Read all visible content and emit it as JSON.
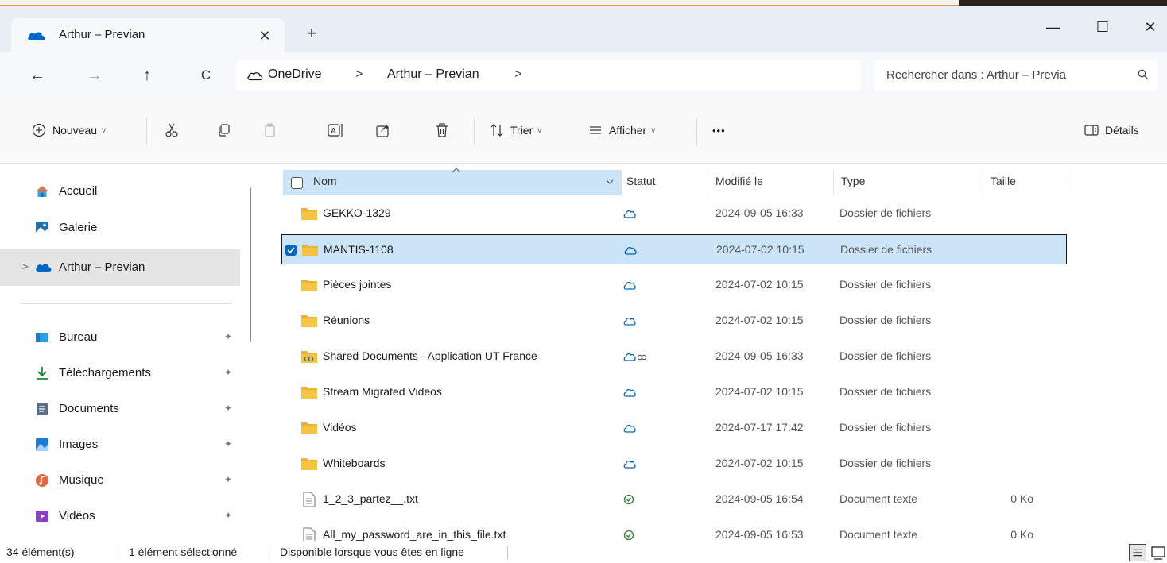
{
  "window": {
    "tab_title": "Arthur – Previan",
    "tab_close": "✕",
    "new_tab": "+",
    "minimize": "—",
    "maximize": "☐",
    "close": "✕"
  },
  "nav": {
    "back": "←",
    "forward": "→",
    "up": "↑",
    "refresh": "C"
  },
  "address": {
    "crumbs": [
      "OneDrive",
      "Arthur – Previan"
    ],
    "sep": ">"
  },
  "search": {
    "placeholder": "Rechercher dans : Arthur – Previa"
  },
  "toolbar": {
    "new_label": "Nouveau",
    "sort_label": "Trier",
    "view_label": "Afficher",
    "more_label": "•••",
    "details_label": "Détails",
    "caret": "v"
  },
  "sidebar": {
    "top_items": [
      {
        "label": "Accueil",
        "icon": "home-icon"
      },
      {
        "label": "Galerie",
        "icon": "gallery-icon"
      },
      {
        "label": "Arthur – Previan",
        "icon": "onedrive-icon",
        "expander": ">"
      }
    ],
    "pinned_items": [
      {
        "label": "Bureau",
        "icon": "desktop-icon",
        "pin": "✦"
      },
      {
        "label": "Téléchargements",
        "icon": "downloads-icon",
        "pin": "✦"
      },
      {
        "label": "Documents",
        "icon": "documents-icon",
        "pin": "✦"
      },
      {
        "label": "Images",
        "icon": "pictures-icon",
        "pin": "✦"
      },
      {
        "label": "Musique",
        "icon": "music-icon",
        "pin": "✦"
      },
      {
        "label": "Vidéos",
        "icon": "videos-icon",
        "pin": "✦"
      }
    ]
  },
  "columns": {
    "name": "Nom",
    "status": "Statut",
    "modified": "Modifié le",
    "type": "Type",
    "size": "Taille"
  },
  "files": [
    {
      "name": "GEKKO-1329",
      "kind": "folder",
      "status": "cloud",
      "modified": "2024-09-05 16:33",
      "type": "Dossier de fichiers",
      "size": ""
    },
    {
      "name": "MANTIS-1108",
      "kind": "folder",
      "status": "cloud",
      "modified": "2024-07-02 10:15",
      "type": "Dossier de fichiers",
      "size": "",
      "selected": true
    },
    {
      "name": "Pièces jointes",
      "kind": "folder",
      "status": "cloud",
      "modified": "2024-07-02 10:15",
      "type": "Dossier de fichiers",
      "size": ""
    },
    {
      "name": "Réunions",
      "kind": "folder",
      "status": "cloud",
      "modified": "2024-07-02 10:15",
      "type": "Dossier de fichiers",
      "size": ""
    },
    {
      "name": "Shared Documents - Application UT France",
      "kind": "shared-folder",
      "status": "cloud-shared",
      "modified": "2024-09-05 16:33",
      "type": "Dossier de fichiers",
      "size": ""
    },
    {
      "name": "Stream Migrated Videos",
      "kind": "folder",
      "status": "cloud",
      "modified": "2024-07-02 10:15",
      "type": "Dossier de fichiers",
      "size": ""
    },
    {
      "name": "Vidéos",
      "kind": "folder",
      "status": "cloud",
      "modified": "2024-07-17 17:42",
      "type": "Dossier de fichiers",
      "size": ""
    },
    {
      "name": "Whiteboards",
      "kind": "folder",
      "status": "cloud",
      "modified": "2024-07-02 10:15",
      "type": "Dossier de fichiers",
      "size": ""
    },
    {
      "name": "1_2_3_partez__.txt",
      "kind": "text",
      "status": "available",
      "modified": "2024-09-05 16:54",
      "type": "Document texte",
      "size": "0 Ko"
    },
    {
      "name": "All_my_password_are_in_this_file.txt",
      "kind": "text",
      "status": "available",
      "modified": "2024-09-05 16:53",
      "type": "Document texte",
      "size": "0 Ko"
    }
  ],
  "status": {
    "count": "34 élément(s)",
    "selected": "1 élément sélectionné",
    "availability": "Disponible lorsque vous êtes en ligne"
  },
  "colors": {
    "accent": "#0067c0",
    "selection": "#cce4f7",
    "folder": "#f6c443",
    "cloud": "#0067c0",
    "available": "#2f7d32"
  }
}
